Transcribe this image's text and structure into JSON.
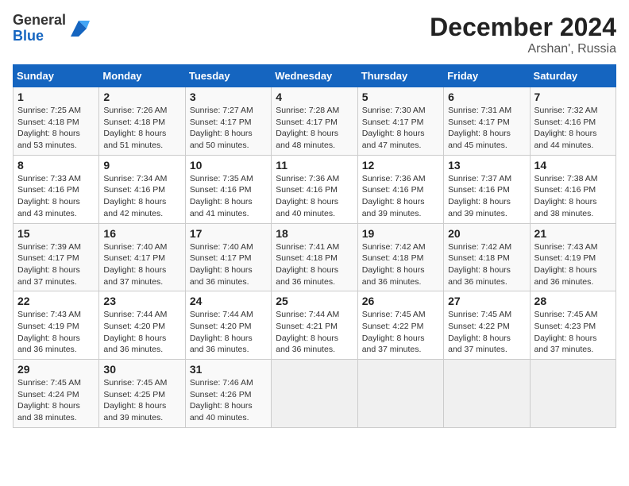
{
  "logo": {
    "line1": "General",
    "line2": "Blue"
  },
  "title": "December 2024",
  "subtitle": "Arshan', Russia",
  "days_header": [
    "Sunday",
    "Monday",
    "Tuesday",
    "Wednesday",
    "Thursday",
    "Friday",
    "Saturday"
  ],
  "weeks": [
    [
      {
        "day": "1",
        "sunrise": "Sunrise: 7:25 AM",
        "sunset": "Sunset: 4:18 PM",
        "daylight": "Daylight: 8 hours and 53 minutes."
      },
      {
        "day": "2",
        "sunrise": "Sunrise: 7:26 AM",
        "sunset": "Sunset: 4:18 PM",
        "daylight": "Daylight: 8 hours and 51 minutes."
      },
      {
        "day": "3",
        "sunrise": "Sunrise: 7:27 AM",
        "sunset": "Sunset: 4:17 PM",
        "daylight": "Daylight: 8 hours and 50 minutes."
      },
      {
        "day": "4",
        "sunrise": "Sunrise: 7:28 AM",
        "sunset": "Sunset: 4:17 PM",
        "daylight": "Daylight: 8 hours and 48 minutes."
      },
      {
        "day": "5",
        "sunrise": "Sunrise: 7:30 AM",
        "sunset": "Sunset: 4:17 PM",
        "daylight": "Daylight: 8 hours and 47 minutes."
      },
      {
        "day": "6",
        "sunrise": "Sunrise: 7:31 AM",
        "sunset": "Sunset: 4:17 PM",
        "daylight": "Daylight: 8 hours and 45 minutes."
      },
      {
        "day": "7",
        "sunrise": "Sunrise: 7:32 AM",
        "sunset": "Sunset: 4:16 PM",
        "daylight": "Daylight: 8 hours and 44 minutes."
      }
    ],
    [
      {
        "day": "8",
        "sunrise": "Sunrise: 7:33 AM",
        "sunset": "Sunset: 4:16 PM",
        "daylight": "Daylight: 8 hours and 43 minutes."
      },
      {
        "day": "9",
        "sunrise": "Sunrise: 7:34 AM",
        "sunset": "Sunset: 4:16 PM",
        "daylight": "Daylight: 8 hours and 42 minutes."
      },
      {
        "day": "10",
        "sunrise": "Sunrise: 7:35 AM",
        "sunset": "Sunset: 4:16 PM",
        "daylight": "Daylight: 8 hours and 41 minutes."
      },
      {
        "day": "11",
        "sunrise": "Sunrise: 7:36 AM",
        "sunset": "Sunset: 4:16 PM",
        "daylight": "Daylight: 8 hours and 40 minutes."
      },
      {
        "day": "12",
        "sunrise": "Sunrise: 7:36 AM",
        "sunset": "Sunset: 4:16 PM",
        "daylight": "Daylight: 8 hours and 39 minutes."
      },
      {
        "day": "13",
        "sunrise": "Sunrise: 7:37 AM",
        "sunset": "Sunset: 4:16 PM",
        "daylight": "Daylight: 8 hours and 39 minutes."
      },
      {
        "day": "14",
        "sunrise": "Sunrise: 7:38 AM",
        "sunset": "Sunset: 4:16 PM",
        "daylight": "Daylight: 8 hours and 38 minutes."
      }
    ],
    [
      {
        "day": "15",
        "sunrise": "Sunrise: 7:39 AM",
        "sunset": "Sunset: 4:17 PM",
        "daylight": "Daylight: 8 hours and 37 minutes."
      },
      {
        "day": "16",
        "sunrise": "Sunrise: 7:40 AM",
        "sunset": "Sunset: 4:17 PM",
        "daylight": "Daylight: 8 hours and 37 minutes."
      },
      {
        "day": "17",
        "sunrise": "Sunrise: 7:40 AM",
        "sunset": "Sunset: 4:17 PM",
        "daylight": "Daylight: 8 hours and 36 minutes."
      },
      {
        "day": "18",
        "sunrise": "Sunrise: 7:41 AM",
        "sunset": "Sunset: 4:18 PM",
        "daylight": "Daylight: 8 hours and 36 minutes."
      },
      {
        "day": "19",
        "sunrise": "Sunrise: 7:42 AM",
        "sunset": "Sunset: 4:18 PM",
        "daylight": "Daylight: 8 hours and 36 minutes."
      },
      {
        "day": "20",
        "sunrise": "Sunrise: 7:42 AM",
        "sunset": "Sunset: 4:18 PM",
        "daylight": "Daylight: 8 hours and 36 minutes."
      },
      {
        "day": "21",
        "sunrise": "Sunrise: 7:43 AM",
        "sunset": "Sunset: 4:19 PM",
        "daylight": "Daylight: 8 hours and 36 minutes."
      }
    ],
    [
      {
        "day": "22",
        "sunrise": "Sunrise: 7:43 AM",
        "sunset": "Sunset: 4:19 PM",
        "daylight": "Daylight: 8 hours and 36 minutes."
      },
      {
        "day": "23",
        "sunrise": "Sunrise: 7:44 AM",
        "sunset": "Sunset: 4:20 PM",
        "daylight": "Daylight: 8 hours and 36 minutes."
      },
      {
        "day": "24",
        "sunrise": "Sunrise: 7:44 AM",
        "sunset": "Sunset: 4:20 PM",
        "daylight": "Daylight: 8 hours and 36 minutes."
      },
      {
        "day": "25",
        "sunrise": "Sunrise: 7:44 AM",
        "sunset": "Sunset: 4:21 PM",
        "daylight": "Daylight: 8 hours and 36 minutes."
      },
      {
        "day": "26",
        "sunrise": "Sunrise: 7:45 AM",
        "sunset": "Sunset: 4:22 PM",
        "daylight": "Daylight: 8 hours and 37 minutes."
      },
      {
        "day": "27",
        "sunrise": "Sunrise: 7:45 AM",
        "sunset": "Sunset: 4:22 PM",
        "daylight": "Daylight: 8 hours and 37 minutes."
      },
      {
        "day": "28",
        "sunrise": "Sunrise: 7:45 AM",
        "sunset": "Sunset: 4:23 PM",
        "daylight": "Daylight: 8 hours and 37 minutes."
      }
    ],
    [
      {
        "day": "29",
        "sunrise": "Sunrise: 7:45 AM",
        "sunset": "Sunset: 4:24 PM",
        "daylight": "Daylight: 8 hours and 38 minutes."
      },
      {
        "day": "30",
        "sunrise": "Sunrise: 7:45 AM",
        "sunset": "Sunset: 4:25 PM",
        "daylight": "Daylight: 8 hours and 39 minutes."
      },
      {
        "day": "31",
        "sunrise": "Sunrise: 7:46 AM",
        "sunset": "Sunset: 4:26 PM",
        "daylight": "Daylight: 8 hours and 40 minutes."
      },
      null,
      null,
      null,
      null
    ]
  ]
}
